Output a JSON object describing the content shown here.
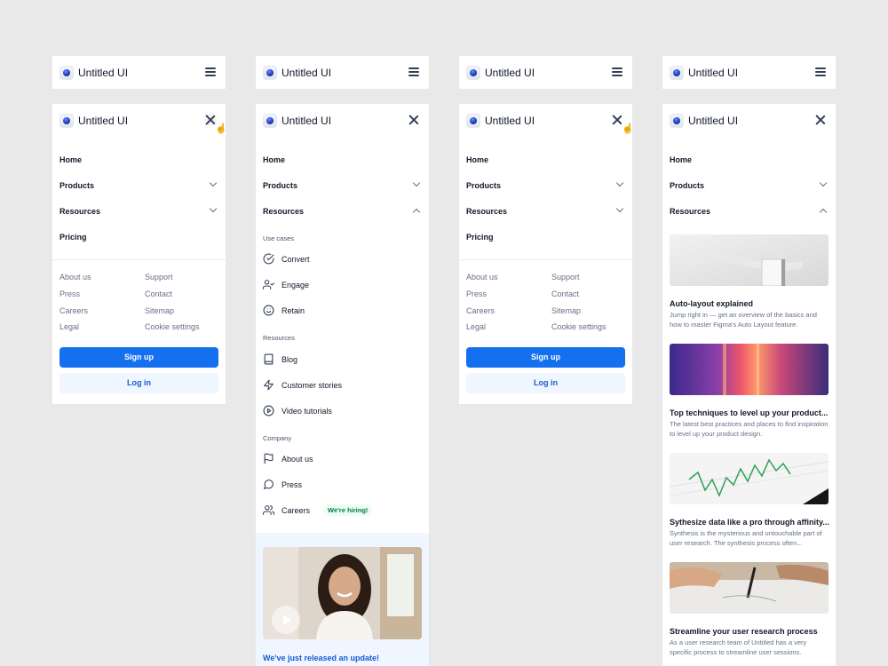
{
  "brand": "Untitled UI",
  "nav": {
    "home": "Home",
    "products": "Products",
    "resources": "Resources",
    "pricing": "Pricing"
  },
  "footer_links": {
    "col1": [
      "About us",
      "Press",
      "Careers",
      "Legal"
    ],
    "col2": [
      "Support",
      "Contact",
      "Sitemap",
      "Cookie settings"
    ]
  },
  "buttons": {
    "signup": "Sign up",
    "login": "Log in"
  },
  "resources_menu": {
    "use_cases_heading": "Use cases",
    "use_cases": [
      "Convert",
      "Engage",
      "Retain"
    ],
    "resources_heading": "Resources",
    "resources": [
      "Blog",
      "Customer stories",
      "Video tutorials"
    ],
    "company_heading": "Company",
    "company": [
      "About us",
      "Press",
      "Careers"
    ],
    "hiring_badge": "We're hiring!",
    "promo_title": "We've just released an update!"
  },
  "articles": [
    {
      "title": "Auto-layout explained",
      "desc": "Jump right in — get an overview of the basics and how to master Figma's Auto Layout feature."
    },
    {
      "title": "Top techniques to level up your product...",
      "desc": "The latest best practices and places to find inspiration to level up your product design."
    },
    {
      "title": "Sythesize data like a pro through affinity...",
      "desc": "Synthesis is the mysterious and untouchable part of user research. The synthesis process often..."
    },
    {
      "title": "Streamline your user research process",
      "desc": "As a user research team of Untitled has a very specific process to streamline user sessions."
    }
  ],
  "colors": {
    "primary": "#1570ef",
    "secondary_bg": "#eff6ff",
    "badge_bg": "#ecfdf3",
    "badge_text": "#027a48",
    "canvas": "#e9e9e9"
  },
  "icons": {
    "convert": "check-circle-icon",
    "engage": "user-check-icon",
    "retain": "smile-icon",
    "blog": "book-icon",
    "customer_stories": "lightning-icon",
    "video_tutorials": "play-circle-icon",
    "about_us": "flag-icon",
    "press": "message-circle-icon",
    "careers": "users-icon"
  }
}
